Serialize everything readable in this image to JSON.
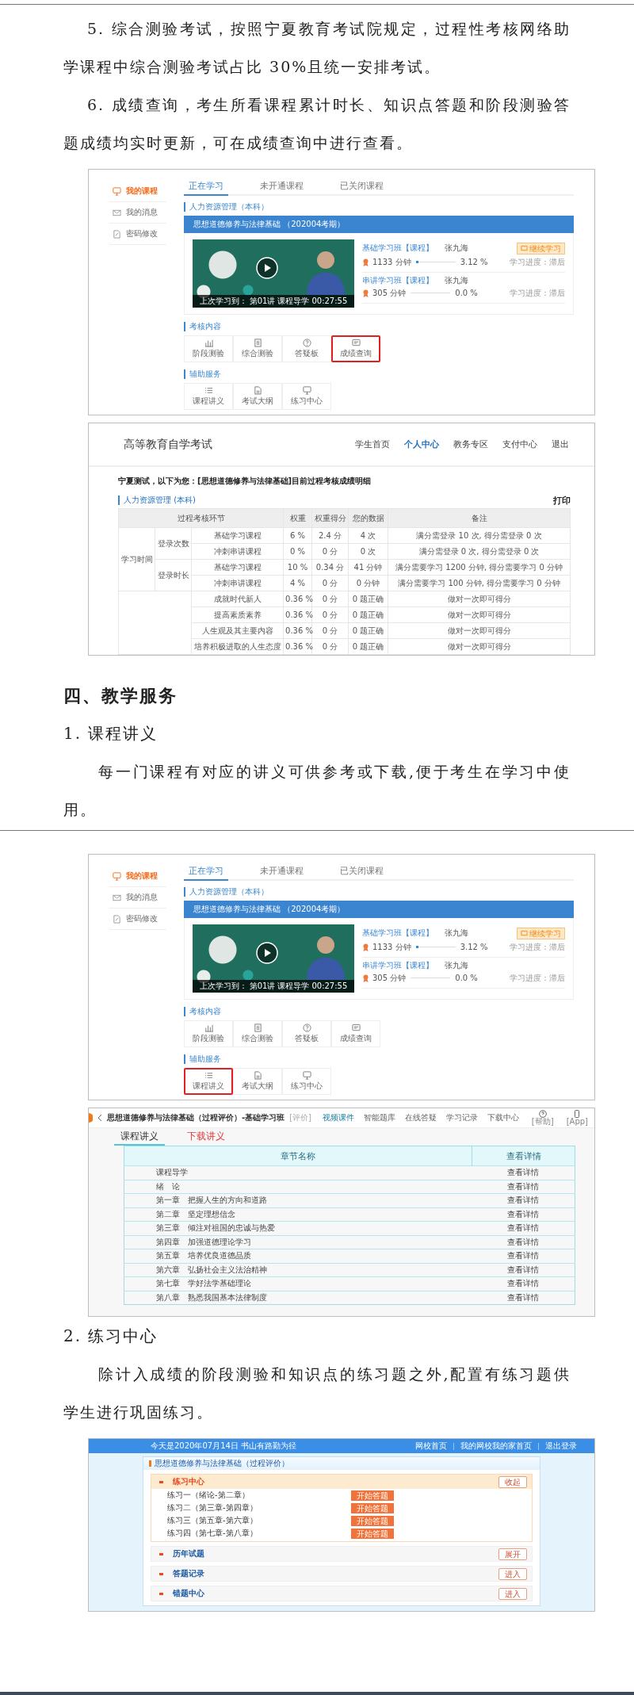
{
  "blocks": [
    {
      "kind": "list_item",
      "text": "5.  综合测验考试，按照宁夏教育考试院规定，过程性考核网络助学课程中综合测验考试占比 30%且统一安排考试。"
    },
    {
      "kind": "list_item",
      "text": "6.  成绩查询，考生所看课程累计时长、知识点答题和阶段测验答题成绩均实时更新，可在成绩查询中进行查看。"
    },
    {
      "kind": "course_screen",
      "sidebar": [
        {
          "label": "我的课程",
          "selected": true
        },
        {
          "label": "我的消息",
          "selected": false
        },
        {
          "label": "密码修改",
          "selected": false
        }
      ],
      "tabs": [
        {
          "label": "正在学习",
          "selected": true
        },
        {
          "label": "未开通课程",
          "selected": false
        },
        {
          "label": "已关闭课程",
          "selected": false
        }
      ],
      "major": "人力资源管理（本科）",
      "course_title": "思想道德修养与法律基础 （202004考期）",
      "video": {
        "last_study": "上次学习到：",
        "lecture": "第01讲",
        "lesson": "课程导学",
        "time": "00:27:55"
      },
      "classes": [
        {
          "name": "基础学习班【课程】",
          "teacher": "张九海",
          "minutes": "1133 分钟",
          "level": 0.0312,
          "percent": "3.12 %",
          "action": "继续学习",
          "progress": "学习进度：滞后"
        },
        {
          "name": "串讲学习班【课程】",
          "teacher": "张九海",
          "minutes": "305 分钟",
          "level": 0,
          "percent": "0.0 %",
          "progress": "学习进度：滞后"
        }
      ],
      "sections": [
        {
          "title": "考核内容",
          "tiles": [
            {
              "label": "阶段测验",
              "highlighted": false
            },
            {
              "label": "综合测验",
              "highlighted": false
            },
            {
              "label": "答疑板",
              "highlighted": false
            },
            {
              "label": "成绩查询",
              "highlighted": true
            }
          ]
        },
        {
          "title": "辅助服务",
          "tiles": [
            {
              "label": "课程讲义",
              "highlighted": false
            },
            {
              "label": "考试大纲",
              "highlighted": false
            },
            {
              "label": "练习中心",
              "highlighted": false
            }
          ]
        }
      ]
    },
    {
      "kind": "grades_screen",
      "site_title": "高等教育自学考试",
      "nav": [
        {
          "label": "学生首页",
          "selected": false
        },
        {
          "label": "个人中心",
          "selected": true
        },
        {
          "label": "教务专区",
          "selected": false
        },
        {
          "label": "支付中心",
          "selected": false
        },
        {
          "label": "退出",
          "selected": false
        }
      ],
      "heading": "宁夏测试，以下为您：[思想道德修养与法律基础]目前过程考核成绩明细",
      "major": "人力资源管理 (本科)",
      "print": "打印",
      "columns": [
        "过程考核环节",
        "权重",
        "权重得分",
        "您的数据",
        "备注"
      ],
      "groups": [
        {
          "label": "学习时间",
          "children": [
            {
              "label": "登录次数",
              "rows": [
                {
                  "item": "基础学习课程",
                  "weight": "6 %",
                  "score": "2.4 分",
                  "data": "4 次",
                  "note": "满分需登录 10 次, 得分需登录 0 次"
                },
                {
                  "item": "冲刺串讲课程",
                  "weight": "0 %",
                  "score": "0 分",
                  "data": "0 次",
                  "note": "满分需登录 0 次, 得分需登录 0 次"
                }
              ]
            },
            {
              "label": "登录时长",
              "rows": [
                {
                  "item": "基础学习课程",
                  "weight": "10 %",
                  "score": "0.34 分",
                  "data": "41 分钟",
                  "note": "满分需要学习 1200 分钟, 得分需要学习 0 分钟"
                },
                {
                  "item": "冲刺串讲课程",
                  "weight": "4 %",
                  "score": "0 分",
                  "data": "0 分钟",
                  "note": "满分需要学习 100 分钟, 得分需要学习 0 分钟"
                }
              ]
            }
          ]
        },
        {
          "children": [
            {
              "rows": [
                {
                  "item": "成就时代新人",
                  "weight": "0.36 %",
                  "score": "0 分",
                  "data": "0 题正确",
                  "note": "做对一次即可得分"
                },
                {
                  "item": "提高素质素养",
                  "weight": "0.36 %",
                  "score": "0 分",
                  "data": "0 题正确",
                  "note": "做对一次即可得分"
                },
                {
                  "item": "人生观及其主要内容",
                  "weight": "0.36 %",
                  "score": "0 分",
                  "data": "0 题正确",
                  "note": "做对一次即可得分"
                },
                {
                  "item": "培养积极进取的人生态度",
                  "weight": "0.36 %",
                  "score": "0 分",
                  "data": "0 题正确",
                  "note": "做对一次即可得分"
                }
              ]
            }
          ]
        }
      ]
    },
    {
      "kind": "heading",
      "text": "四、教学服务"
    },
    {
      "kind": "subheading",
      "text": "1. 课程讲义"
    },
    {
      "kind": "body",
      "text": "每一门课程有对应的讲义可供参考或下载,便于考生在学习中使用。"
    },
    {
      "kind": "page_break"
    },
    {
      "kind": "course_screen",
      "sidebar": [
        {
          "label": "我的课程",
          "selected": true
        },
        {
          "label": "我的消息",
          "selected": false
        },
        {
          "label": "密码修改",
          "selected": false
        }
      ],
      "tabs": [
        {
          "label": "正在学习",
          "selected": true
        },
        {
          "label": "未开通课程",
          "selected": false
        },
        {
          "label": "已关闭课程",
          "selected": false
        }
      ],
      "major": "人力资源管理（本科）",
      "course_title": "思想道德修养与法律基础 （202004考期）",
      "video": {
        "last_study": "上次学习到：",
        "lecture": "第01讲",
        "lesson": "课程导学",
        "time": "00:27:55"
      },
      "classes": [
        {
          "name": "基础学习班【课程】",
          "teacher": "张九海",
          "minutes": "1133 分钟",
          "level": 0.0312,
          "percent": "3.12 %",
          "action": "继续学习",
          "progress": "学习进度：滞后"
        },
        {
          "name": "串讲学习班【课程】",
          "teacher": "张九海",
          "minutes": "305 分钟",
          "level": 0,
          "percent": "0.0 %",
          "progress": "学习进度：滞后"
        }
      ],
      "sections": [
        {
          "title": "考核内容",
          "tiles": [
            {
              "label": "阶段测验",
              "highlighted": false
            },
            {
              "label": "综合测验",
              "highlighted": false
            },
            {
              "label": "答疑板",
              "highlighted": false
            },
            {
              "label": "成绩查询",
              "highlighted": false
            }
          ]
        },
        {
          "title": "辅助服务",
          "tiles": [
            {
              "label": "课程讲义",
              "highlighted": true
            },
            {
              "label": "考试大纲",
              "highlighted": false
            },
            {
              "label": "练习中心",
              "highlighted": false
            }
          ]
        }
      ]
    },
    {
      "kind": "handouts_screen",
      "title": "思想道德修养与法律基础（过程评价）-基础学习班",
      "title_tag": "[评价]",
      "nav": [
        {
          "label": "视频课件",
          "selected": true
        },
        {
          "label": "智能题库",
          "selected": false
        },
        {
          "label": "在线答疑",
          "selected": false
        },
        {
          "label": "学习记录",
          "selected": false
        },
        {
          "label": "下载中心",
          "selected": false
        }
      ],
      "tools": [
        "[帮助]",
        "[App]"
      ],
      "tabs": [
        {
          "label": "课程讲义",
          "selected": true
        },
        {
          "label": "下载讲义",
          "selected": false
        }
      ],
      "columns": [
        "章节名称",
        "查看详情"
      ],
      "rows": [
        {
          "chapter": "课程导学",
          "action": "查看详情"
        },
        {
          "chapter": "绪　论",
          "action": "查看详情"
        },
        {
          "chapter": "第一章　把握人生的方向和道路",
          "action": "查看详情"
        },
        {
          "chapter": "第二章　坚定理想信念",
          "action": "查看详情"
        },
        {
          "chapter": "第三章　倾注对祖国的忠诚与热爱",
          "action": "查看详情"
        },
        {
          "chapter": "第四章　加强道德理论学习",
          "action": "查看详情"
        },
        {
          "chapter": "第五章　培养优良道德品质",
          "action": "查看详情"
        },
        {
          "chapter": "第六章　弘扬社会主义法治精神",
          "action": "查看详情"
        },
        {
          "chapter": "第七章　学好法学基础理论",
          "action": "查看详情"
        },
        {
          "chapter": "第八章　熟悉我国基本法律制度",
          "action": "查看详情"
        }
      ]
    },
    {
      "kind": "subheading",
      "text": "2. 练习中心"
    },
    {
      "kind": "body",
      "text": "除计入成绩的阶段测验和知识点的练习题之外,配置有练习题供学生进行巩固练习。"
    },
    {
      "kind": "practice_screen",
      "greeting": "今天是2020年07月14日  书山有路勤为径",
      "links": [
        "网校首页",
        "我的网校我的家首页",
        "退出登录"
      ],
      "course": "思想道德修养与法律基础（过程评价）",
      "sections": [
        {
          "title": "练习中心",
          "expanded": true,
          "button": "收起",
          "items": [
            {
              "label": "练习一（绪论-第二章）",
              "button": "开始答题"
            },
            {
              "label": "练习二（第三章-第四章）",
              "button": "开始答题"
            },
            {
              "label": "练习三（第五章-第六章）",
              "button": "开始答题"
            },
            {
              "label": "练习四（第七章-第八章）",
              "button": "开始答题"
            }
          ]
        },
        {
          "title": "历年试题",
          "expanded": false,
          "button": "展开"
        },
        {
          "title": "答题记录",
          "expanded": false,
          "button": "进入"
        },
        {
          "title": "错题中心",
          "expanded": false,
          "button": "进入"
        }
      ]
    }
  ]
}
